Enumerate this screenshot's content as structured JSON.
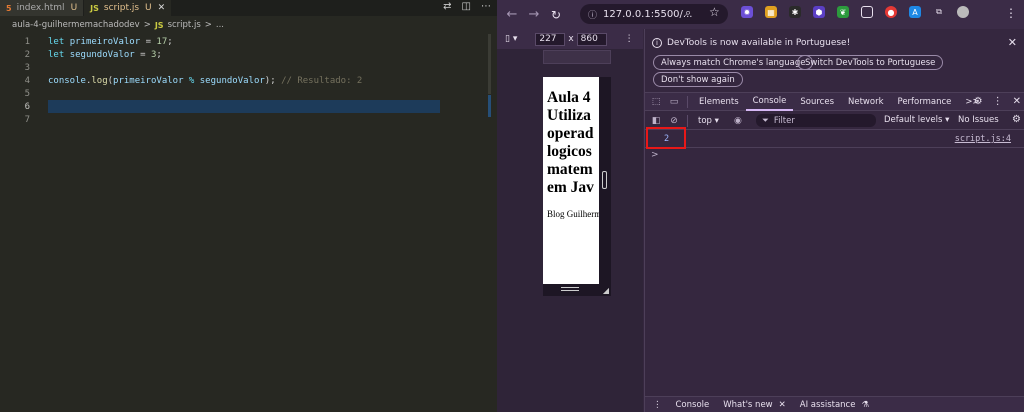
{
  "vscode": {
    "tabs": [
      {
        "icon": "5",
        "label": "index.html",
        "status": "U",
        "active": false
      },
      {
        "icon": "JS",
        "label": "script.js",
        "status": "U",
        "active": true
      }
    ],
    "close_glyph": "✕",
    "breadcrumb": {
      "folder": "aula-4-guilhermemachadodev",
      "sep": ">",
      "icon": "JS",
      "file": "script.js",
      "sep2": ">",
      "rest": "..."
    },
    "code": [
      {
        "n": "1",
        "kw": "let",
        "var": "primeiroValor",
        "op": "=",
        "num": "17",
        "end": ";"
      },
      {
        "n": "2",
        "kw": "let",
        "var": "segundoValor",
        "op": "=",
        "num": "3",
        "end": ";"
      },
      {
        "n": "3"
      },
      {
        "n": "4",
        "obj": "console",
        "dot": ".",
        "fn": "log",
        "open": "(",
        "a": "primeiroValor",
        "op": "%",
        "b": "segundoValor",
        "close": ");",
        "comment": "// Resultado: 2"
      },
      {
        "n": "5"
      },
      {
        "n": "6"
      },
      {
        "n": "7"
      }
    ]
  },
  "chrome": {
    "url": "127.0.0.1:5500/...",
    "device": {
      "width": "227",
      "x": "x",
      "height": "860"
    },
    "page": {
      "title_lines": [
        "Aula 4",
        "Utiliza",
        "operad",
        "logicos",
        "matem",
        "em Jav"
      ],
      "byline": "Blog Guilherm"
    },
    "infobar": {
      "message": "DevTools is now available in Portuguese!",
      "buttons": [
        "Always match Chrome's language",
        "Switch DevTools to Portuguese",
        "Don't show again"
      ]
    },
    "devtools_tabs": [
      "Elements",
      "Console",
      "Sources",
      "Network",
      "Performance"
    ],
    "devtools_more": ">>",
    "active_tab": "Console",
    "console_bar": {
      "context": "top ▾",
      "filter_placeholder": "Filter",
      "levels": "Default levels ▾",
      "issues": "No Issues"
    },
    "console": {
      "value": "2",
      "source": "script.js:4",
      "prompt": ">"
    },
    "drawer": {
      "console": "Console",
      "whats_new": "What's new",
      "ai": "AI assistance"
    }
  }
}
